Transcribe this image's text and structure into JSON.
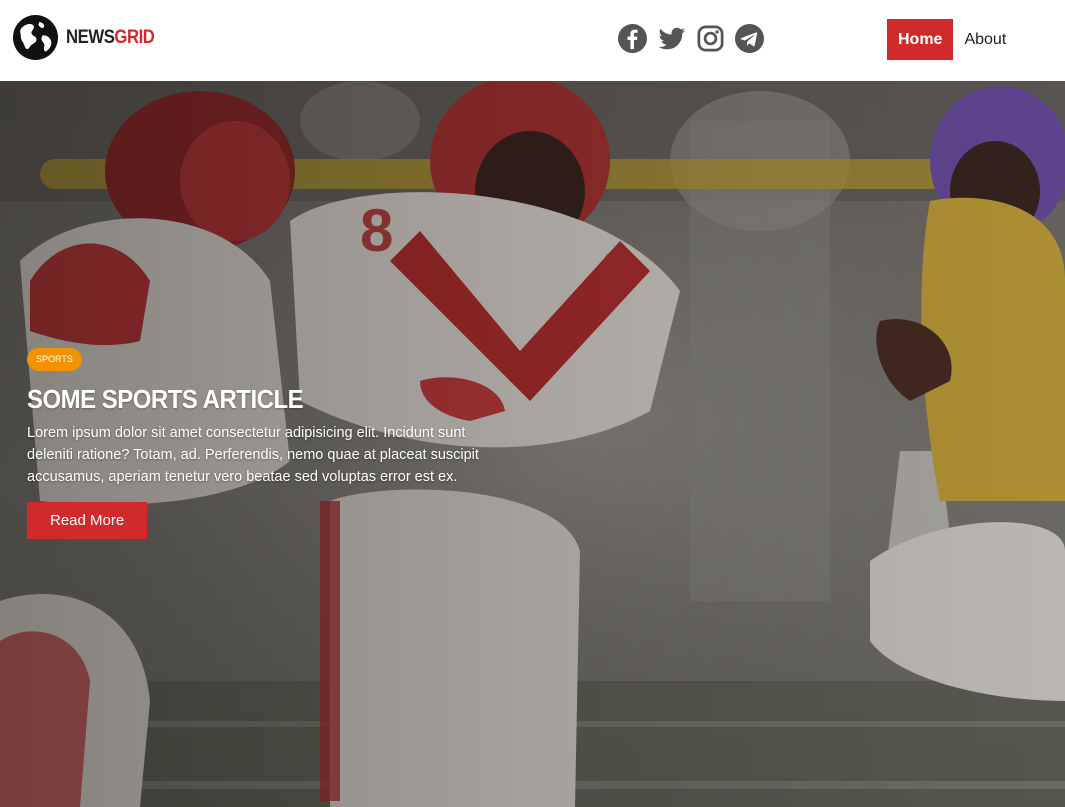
{
  "brand": {
    "name_part1": "NEWS",
    "name_part2": "GRID",
    "logo_icon": "globe-icon",
    "accent": "#d12a2a"
  },
  "social": [
    {
      "icon": "facebook-icon"
    },
    {
      "icon": "twitter-icon"
    },
    {
      "icon": "instagram-icon"
    },
    {
      "icon": "telegram-icon"
    }
  ],
  "nav": {
    "items": [
      {
        "label": "Home",
        "active": true
      },
      {
        "label": "About",
        "active": false
      }
    ]
  },
  "hero": {
    "category": "SPORTS",
    "category_color": "#f39200",
    "title": "SOME SPORTS ARTICLE",
    "excerpt": "Lorem ipsum dolor sit amet consectetur adipisicing elit. Incidunt sunt deleniti ratione? Totam, ad. Perferendis, nemo quae at placeat suscipit accusamus, aperiam tenetur vero beatae sed voluptas error est ex.",
    "read_more_label": "Read More"
  }
}
